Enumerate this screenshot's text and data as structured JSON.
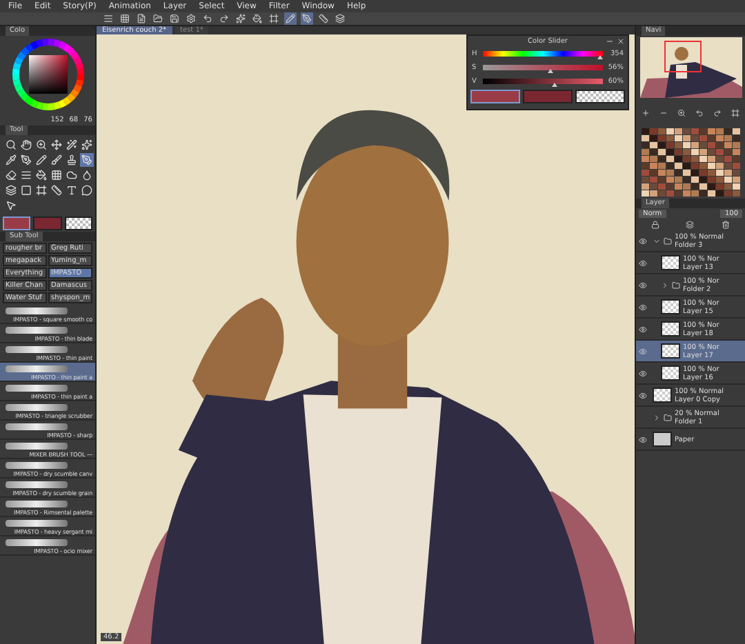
{
  "menu": [
    "File",
    "Edit",
    "Story(P)",
    "Animation",
    "Layer",
    "Select",
    "View",
    "Filter",
    "Window",
    "Help"
  ],
  "document_tabs": [
    {
      "label": "Eisenrich couch 2*",
      "selected": true
    },
    {
      "label": "test 1*",
      "selected": false
    }
  ],
  "color_wheel": {
    "tab": "Colo",
    "red": "152",
    "green": "68",
    "blue": "76"
  },
  "tool_panel": {
    "tab": "Tool",
    "tools": [
      {
        "kind": "search",
        "selected": false
      },
      {
        "kind": "hand",
        "selected": false
      },
      {
        "kind": "zoom",
        "selected": false
      },
      {
        "kind": "move",
        "selected": false
      },
      {
        "kind": "wand",
        "selected": false
      },
      {
        "kind": "sparkle",
        "selected": false
      },
      {
        "kind": "dropper",
        "selected": false
      },
      {
        "kind": "pen",
        "selected": false
      },
      {
        "kind": "pencil",
        "selected": false
      },
      {
        "kind": "brush",
        "selected": false
      },
      {
        "kind": "stamp",
        "selected": false
      },
      {
        "kind": "pen",
        "selected": true
      },
      {
        "kind": "eraser",
        "selected": false
      },
      {
        "kind": "lines",
        "selected": false
      },
      {
        "kind": "bucket",
        "selected": false
      },
      {
        "kind": "grid",
        "selected": false
      },
      {
        "kind": "cloud",
        "selected": false
      },
      {
        "kind": "fill",
        "selected": false
      },
      {
        "kind": "gradient",
        "selected": false
      },
      {
        "kind": "square",
        "selected": false
      },
      {
        "kind": "frame",
        "selected": false
      },
      {
        "kind": "ruler",
        "selected": false
      },
      {
        "kind": "text",
        "selected": false
      },
      {
        "kind": "bubble",
        "selected": false
      },
      {
        "kind": "pointer",
        "selected": false
      }
    ]
  },
  "swatches": [
    {
      "kind": "solid",
      "color": "#9a3c47",
      "selected": true
    },
    {
      "kind": "solid",
      "color": "#7b2731",
      "selected": false
    },
    {
      "kind": "transparent",
      "selected": false
    }
  ],
  "sub_tool": {
    "tab": "Sub Tool",
    "groups": [
      {
        "label": "rougher br",
        "selected": false
      },
      {
        "label": "Greg Ruti",
        "selected": false
      },
      {
        "label": "megapack",
        "selected": false
      },
      {
        "label": "Yuming_m",
        "selected": false
      },
      {
        "label": "Everything",
        "selected": false
      },
      {
        "label": "IMPASTO",
        "selected": true
      },
      {
        "label": "Killer Chan",
        "selected": false
      },
      {
        "label": "Damascus",
        "selected": false
      },
      {
        "label": "Water Stuf",
        "selected": false
      },
      {
        "label": "shyspon_m",
        "selected": false
      }
    ]
  },
  "brushes": [
    {
      "label": "IMPASTO - square smooth co",
      "selected": false
    },
    {
      "label": "IMPASTO - thin blade",
      "selected": false
    },
    {
      "label": "IMPASTO - thin paint",
      "selected": false
    },
    {
      "label": "IMPASTO - thin paint a",
      "selected": true
    },
    {
      "label": "IMPASTO - thin paint a",
      "selected": false
    },
    {
      "label": "IMPASTO - triangle scrubber",
      "selected": false
    },
    {
      "label": "IMPASTO - sharp",
      "selected": false
    },
    {
      "label": "MIXER BRUSH TOOL —",
      "selected": false
    },
    {
      "label": "IMPASTO - dry scumble canv",
      "selected": false
    },
    {
      "label": "IMPASTO - dry scumble grain",
      "selected": false
    },
    {
      "label": "IMPASTO - Rimsental palette",
      "selected": false
    },
    {
      "label": "IMPASTO - heavy sergant mi",
      "selected": false
    },
    {
      "label": "IMPASTO - ocio mixer",
      "selected": false
    }
  ],
  "color_slider": {
    "title": "Color Slider",
    "sliders": [
      {
        "kind": "hue",
        "label": "H",
        "level": 0.98,
        "reading": "354"
      },
      {
        "kind": "saturation",
        "label": "S",
        "level": 0.56,
        "reading": "56%"
      },
      {
        "kind": "value",
        "label": "V",
        "level": 0.6,
        "reading": "60%"
      }
    ],
    "swatches": [
      {
        "kind": "solid",
        "color": "#9a3c47",
        "selected": true
      },
      {
        "kind": "solid",
        "color": "#7b2731",
        "selected": false
      },
      {
        "kind": "transparent",
        "selected": false
      }
    ]
  },
  "canvas": {
    "zoom": "46.2"
  },
  "navigator": {
    "tab": "Navi"
  },
  "layers": {
    "tab": "Layer",
    "blend": "Norm",
    "opacity": "100",
    "items": [
      {
        "mode": "100 % Normal",
        "name": "Folder 3",
        "kind": "folder",
        "visible": true,
        "selected": false,
        "expanded": true,
        "children": [
          {
            "mode": "100 % Nor",
            "name": "Layer 13",
            "kind": "layer",
            "visible": true,
            "selected": false
          },
          {
            "mode": "100 % Nor",
            "name": "Folder 2",
            "kind": "folder",
            "visible": true,
            "selected": false,
            "expanded": false
          },
          {
            "mode": "100 % Nor",
            "name": "Layer 15",
            "kind": "layer",
            "visible": true,
            "selected": false
          },
          {
            "mode": "100 % Nor",
            "name": "Layer 18",
            "kind": "layer",
            "visible": true,
            "selected": false
          },
          {
            "mode": "100 % Nor",
            "name": "Layer 17",
            "kind": "layer",
            "visible": true,
            "selected": true
          },
          {
            "mode": "100 % Nor",
            "name": "Layer 16",
            "kind": "layer",
            "visible": true,
            "selected": false
          }
        ]
      },
      {
        "mode": "100 % Normal",
        "name": "Layer 0 Copy",
        "kind": "layer",
        "visible": true,
        "selected": false
      },
      {
        "mode": "20 % Normal",
        "name": "Folder 1",
        "kind": "folder",
        "visible": false,
        "selected": false,
        "expanded": false
      },
      {
        "name": "Paper",
        "kind": "paper",
        "visible": true,
        "selected": false
      }
    ]
  }
}
